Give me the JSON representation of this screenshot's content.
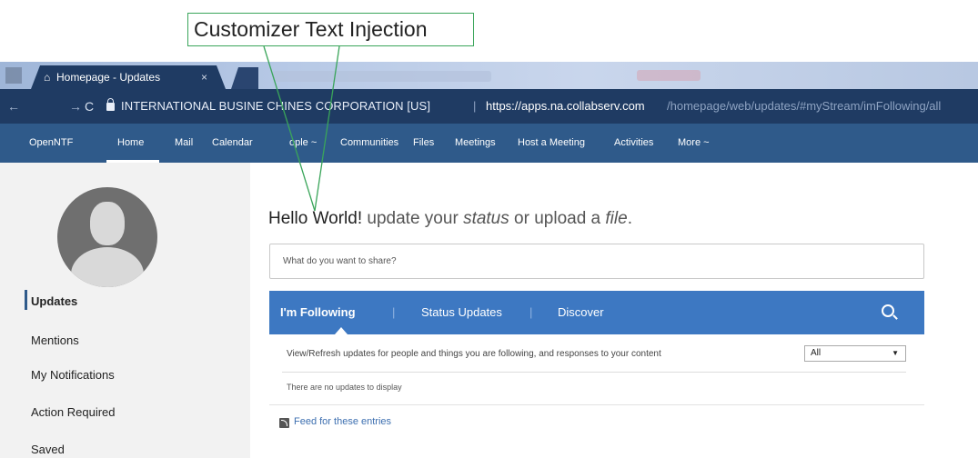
{
  "annotation": {
    "callout_text": "Customizer Text Injection"
  },
  "browser": {
    "tab_title": "Homepage - Updates",
    "tab_close": "×",
    "nav_back": "←",
    "nav_forward": "→",
    "nav_reload": "C",
    "url_org": "INTERNATIONAL BUSINE      CHINES CORPORATION [US]",
    "url_separator": "|",
    "url_host": "https://apps.na.collabserv.com",
    "url_path": "/homepage/web/updates/#myStream/imFollowing/all"
  },
  "appnav": {
    "items": [
      "OpenNTF",
      "Home",
      "Mail",
      "Calendar",
      "ople ~",
      "Communities",
      "Files",
      "Meetings",
      "Host a Meeting",
      "Activities",
      "More ~"
    ]
  },
  "sidebar": {
    "items": [
      "Updates",
      "Mentions",
      "My Notifications",
      "Action Required",
      "Saved"
    ]
  },
  "main": {
    "hello_prefix": "Hello World!",
    "hello_update": " update your ",
    "hello_status": "status",
    "hello_or": " or upload a ",
    "hello_file": "file",
    "hello_end": ".",
    "share_placeholder": "What do you want to share?",
    "stream_tabs": [
      "I'm Following",
      "Status Updates",
      "Discover"
    ],
    "separator": "|",
    "filter_text": "View/Refresh updates for people and things you are following, and responses to your content",
    "filter_select": "All",
    "filter_caret": "▼",
    "no_updates": "There are no updates to display",
    "feed_link": "Feed for these entries"
  },
  "colors": {
    "url_bar": "#1f3b63",
    "app_nav": "#2f5a8a",
    "stream_bar": "#3d78c2",
    "callout_border": "#3aa55a",
    "sidebar_bg": "#f2f2f2"
  }
}
